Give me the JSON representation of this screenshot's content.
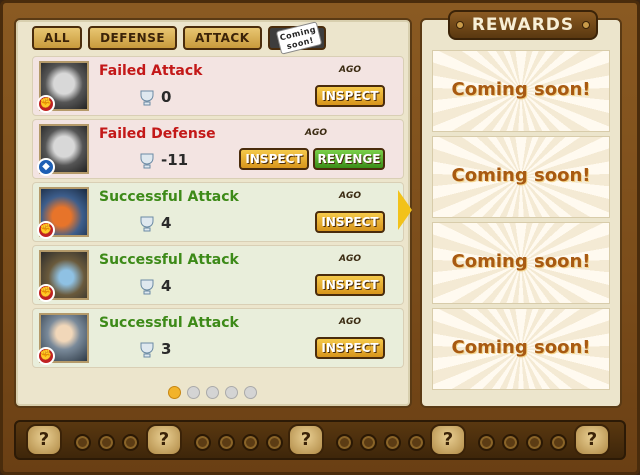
{
  "tabs": [
    {
      "label": "ALL"
    },
    {
      "label": "DEFENSE"
    },
    {
      "label": "ATTACK"
    },
    {
      "label": "Coming soon!"
    }
  ],
  "battles": [
    {
      "title": "Failed Attack",
      "result": "fail",
      "type": "attack",
      "ago": "AGO",
      "score": "0",
      "buttons": [
        "INSPECT"
      ]
    },
    {
      "title": "Failed Defense",
      "result": "fail",
      "type": "defense",
      "ago": "AGO",
      "score": "-11",
      "buttons": [
        "INSPECT",
        "REVENGE"
      ]
    },
    {
      "title": "Successful Attack",
      "result": "success",
      "type": "attack",
      "ago": "AGO",
      "score": "4",
      "buttons": [
        "INSPECT"
      ]
    },
    {
      "title": "Successful Attack",
      "result": "success",
      "type": "attack",
      "ago": "AGO",
      "score": "4",
      "buttons": [
        "INSPECT"
      ]
    },
    {
      "title": "Successful Attack",
      "result": "success",
      "type": "attack",
      "ago": "AGO",
      "score": "3",
      "buttons": [
        "INSPECT"
      ]
    }
  ],
  "pager": {
    "pages": 5,
    "current": 1
  },
  "rewards": {
    "title": "REWARDS",
    "cards": [
      "Coming soon!",
      "Coming soon!",
      "Coming soon!",
      "Coming soon!"
    ]
  },
  "bottom_bar": {
    "slot_label": "?"
  }
}
